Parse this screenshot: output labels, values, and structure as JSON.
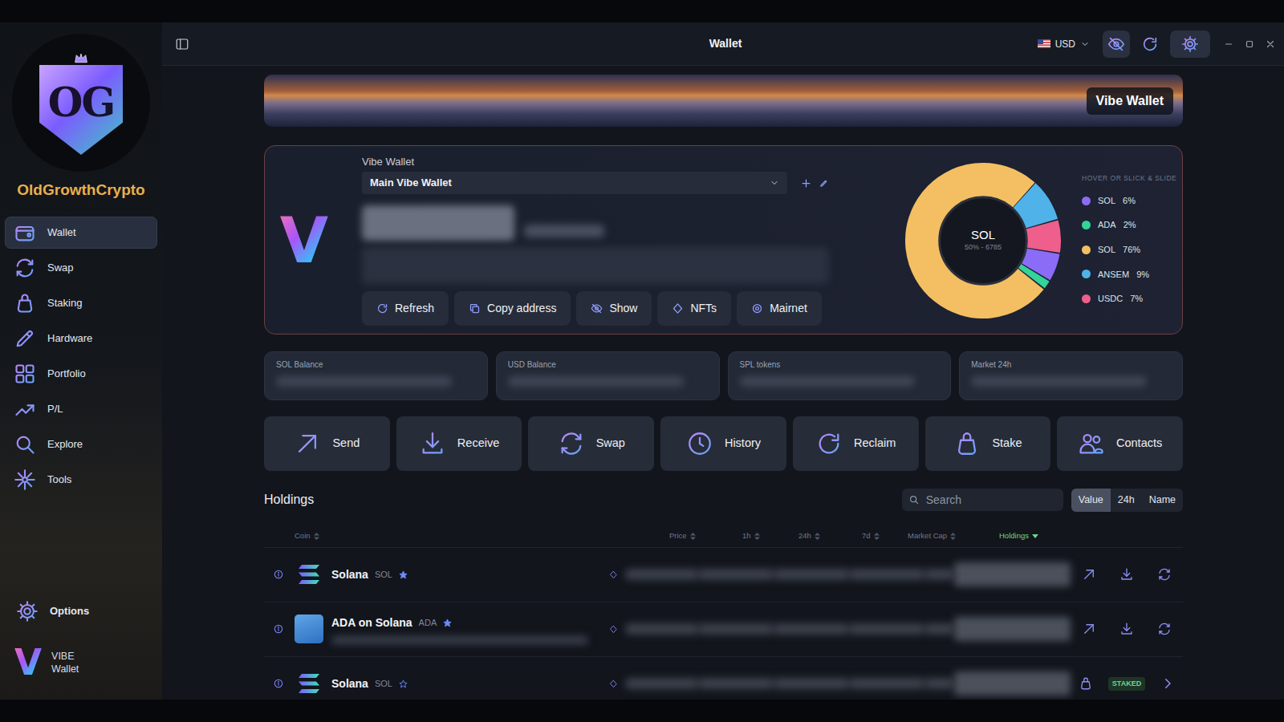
{
  "window": {
    "title": "Wallet",
    "currency": "USD"
  },
  "brand": {
    "logo": "OG",
    "name": "OldGrowthCrypto"
  },
  "sidebar": {
    "items": [
      {
        "label": "Wallet",
        "selected": true
      },
      {
        "label": "Swap",
        "selected": false
      },
      {
        "label": "Staking",
        "selected": false
      },
      {
        "label": "Hardware",
        "selected": false
      },
      {
        "label": "Portfolio",
        "selected": false
      },
      {
        "label": "P/L",
        "selected": false
      },
      {
        "label": "Explore",
        "selected": false
      },
      {
        "label": "Tools",
        "selected": false
      }
    ],
    "options": "Options",
    "footer": {
      "mark": "V",
      "line1": "VIBE",
      "line2": "Wallet"
    }
  },
  "banner": {
    "label": "Vibe Wallet"
  },
  "wallet": {
    "mark": "V",
    "label": "Vibe Wallet",
    "selected_wallet": "Main Vibe Wallet",
    "balance_hidden": true,
    "actions": [
      "Refresh",
      "Copy address",
      "Show",
      "NFTs",
      "Mairnet"
    ],
    "chart": {
      "center_label": "SOL",
      "center_sub": "50% - 6785",
      "legend_title": "HOVER OR SLICK & SLIDE",
      "slices": [
        {
          "name": "SOL",
          "share": "6%",
          "value": 6,
          "color": "#8b6cf6"
        },
        {
          "name": "ADA",
          "share": "2%",
          "value": 2,
          "color": "#34d39a"
        },
        {
          "name": "SOL",
          "share": "76%",
          "value": 76,
          "color": "#f4bf62"
        },
        {
          "name": "ANSEM",
          "share": "9%",
          "value": 9,
          "color": "#4fb3ea"
        },
        {
          "name": "USDC",
          "share": "7%",
          "value": 7,
          "color": "#ee5f8c"
        }
      ]
    }
  },
  "stats": [
    {
      "label": "SOL Balance"
    },
    {
      "label": "USD Balance"
    },
    {
      "label": "SPL tokens"
    },
    {
      "label": "Market 24h"
    }
  ],
  "quick_actions": [
    "Send",
    "Receive",
    "Swap",
    "History",
    "Reclaim",
    "Stake",
    "Contacts"
  ],
  "holdings": {
    "title": "Holdings",
    "search": {
      "placeholder": "Search"
    },
    "sorts": [
      {
        "label": "Value",
        "selected": true
      },
      {
        "label": "24h",
        "selected": false
      },
      {
        "label": "Name",
        "selected": false
      }
    ],
    "columns": [
      {
        "label": "Coin",
        "selected": false
      },
      {
        "label": "Price",
        "selected": false
      },
      {
        "label": "1h",
        "selected": false
      },
      {
        "label": "24h",
        "selected": false
      },
      {
        "label": "7d",
        "selected": false
      },
      {
        "label": "Market Cap",
        "selected": false
      },
      {
        "label": "Holdings",
        "selected": true
      }
    ],
    "rows": [
      {
        "name": "Solana",
        "symbol": "SOL",
        "starred": true,
        "blurred_detail": false,
        "kind": "wallet",
        "badge": ""
      },
      {
        "name": "ADA on Solana",
        "symbol": "ADA",
        "starred": true,
        "blurred_detail": true,
        "kind": "wallet",
        "badge": ""
      },
      {
        "name": "Solana",
        "symbol": "SOL",
        "starred": false,
        "blurred_detail": false,
        "kind": "staked",
        "badge": "STAKED"
      }
    ]
  }
}
